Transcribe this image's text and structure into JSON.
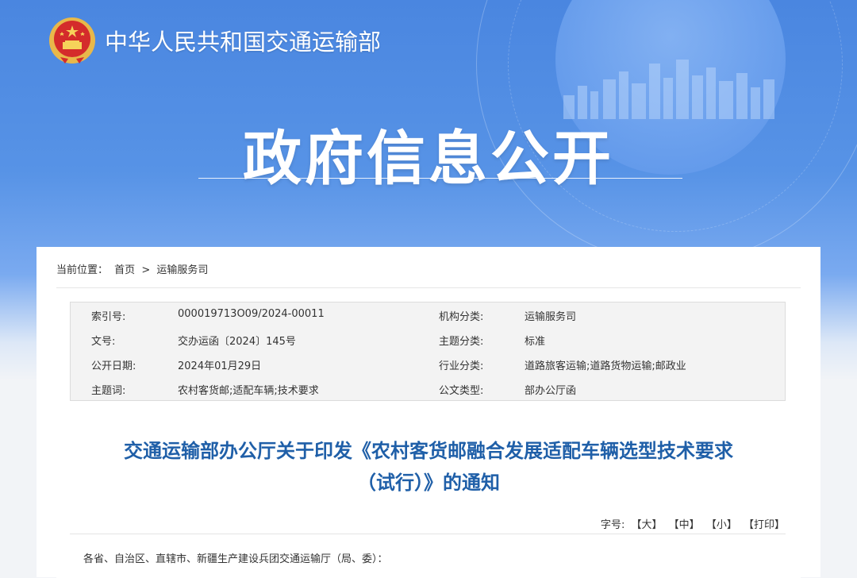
{
  "header": {
    "ministry_name": "中华人民共和国交通运输部",
    "section_title": "政府信息公开"
  },
  "breadcrumb": {
    "label": "当前位置：",
    "items": [
      "首页",
      ">",
      "运输服务司"
    ]
  },
  "meta": {
    "rows": [
      {
        "k1": "索引号:",
        "v1": "000019713O09/2024-00011",
        "k2": "机构分类:",
        "v2": "运输服务司"
      },
      {
        "k1": "文号:",
        "v1": "交办运函〔2024〕145号",
        "k2": "主题分类:",
        "v2": "标准"
      },
      {
        "k1": "公开日期:",
        "v1": "2024年01月29日",
        "k2": "行业分类:",
        "v2": "道路旅客运输;道路货物运输;邮政业"
      },
      {
        "k1": "主题词:",
        "v1": "农村客货邮;适配车辆;技术要求",
        "k2": "公文类型:",
        "v2": "部办公厅函"
      }
    ]
  },
  "document": {
    "title_line1": "交通运输部办公厅关于印发《农村客货邮融合发展适配车辆选型技术要求",
    "title_line2": "（试行）》的通知",
    "addressee": "各省、自治区、直辖市、新疆生产建设兵团交通运输厅（局、委）："
  },
  "font_size": {
    "label": "字号:",
    "large": "【大】",
    "medium": "【中】",
    "small": "【小】",
    "print": "【打印】"
  },
  "colors": {
    "title_blue": "#1f5fa8",
    "banner_blue": "#4a86e0"
  }
}
